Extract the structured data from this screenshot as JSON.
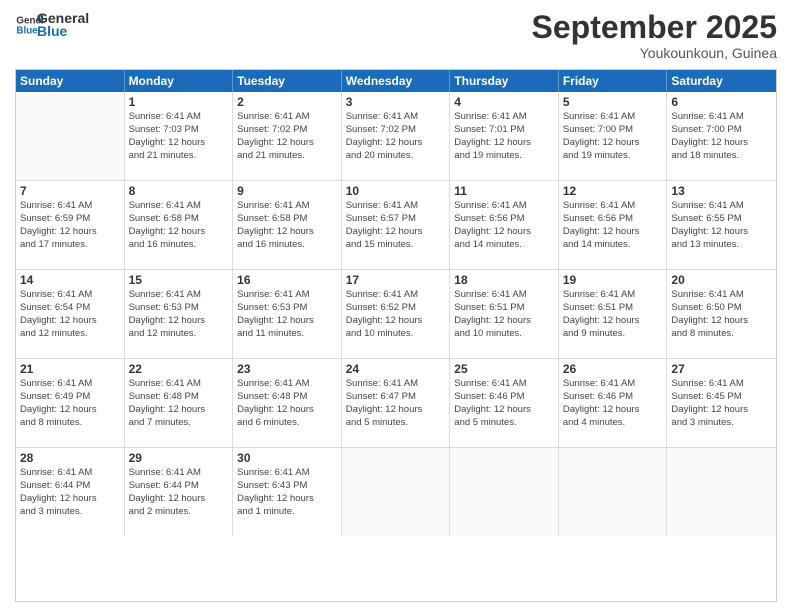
{
  "header": {
    "logo_line1": "General",
    "logo_line2": "Blue",
    "month": "September 2025",
    "location": "Youkounkoun, Guinea"
  },
  "days": [
    "Sunday",
    "Monday",
    "Tuesday",
    "Wednesday",
    "Thursday",
    "Friday",
    "Saturday"
  ],
  "weeks": [
    [
      {
        "day": "",
        "info": ""
      },
      {
        "day": "1",
        "info": "Sunrise: 6:41 AM\nSunset: 7:03 PM\nDaylight: 12 hours\nand 21 minutes."
      },
      {
        "day": "2",
        "info": "Sunrise: 6:41 AM\nSunset: 7:02 PM\nDaylight: 12 hours\nand 21 minutes."
      },
      {
        "day": "3",
        "info": "Sunrise: 6:41 AM\nSunset: 7:02 PM\nDaylight: 12 hours\nand 20 minutes."
      },
      {
        "day": "4",
        "info": "Sunrise: 6:41 AM\nSunset: 7:01 PM\nDaylight: 12 hours\nand 19 minutes."
      },
      {
        "day": "5",
        "info": "Sunrise: 6:41 AM\nSunset: 7:00 PM\nDaylight: 12 hours\nand 19 minutes."
      },
      {
        "day": "6",
        "info": "Sunrise: 6:41 AM\nSunset: 7:00 PM\nDaylight: 12 hours\nand 18 minutes."
      }
    ],
    [
      {
        "day": "7",
        "info": "Sunrise: 6:41 AM\nSunset: 6:59 PM\nDaylight: 12 hours\nand 17 minutes."
      },
      {
        "day": "8",
        "info": "Sunrise: 6:41 AM\nSunset: 6:58 PM\nDaylight: 12 hours\nand 16 minutes."
      },
      {
        "day": "9",
        "info": "Sunrise: 6:41 AM\nSunset: 6:58 PM\nDaylight: 12 hours\nand 16 minutes."
      },
      {
        "day": "10",
        "info": "Sunrise: 6:41 AM\nSunset: 6:57 PM\nDaylight: 12 hours\nand 15 minutes."
      },
      {
        "day": "11",
        "info": "Sunrise: 6:41 AM\nSunset: 6:56 PM\nDaylight: 12 hours\nand 14 minutes."
      },
      {
        "day": "12",
        "info": "Sunrise: 6:41 AM\nSunset: 6:56 PM\nDaylight: 12 hours\nand 14 minutes."
      },
      {
        "day": "13",
        "info": "Sunrise: 6:41 AM\nSunset: 6:55 PM\nDaylight: 12 hours\nand 13 minutes."
      }
    ],
    [
      {
        "day": "14",
        "info": "Sunrise: 6:41 AM\nSunset: 6:54 PM\nDaylight: 12 hours\nand 12 minutes."
      },
      {
        "day": "15",
        "info": "Sunrise: 6:41 AM\nSunset: 6:53 PM\nDaylight: 12 hours\nand 12 minutes."
      },
      {
        "day": "16",
        "info": "Sunrise: 6:41 AM\nSunset: 6:53 PM\nDaylight: 12 hours\nand 11 minutes."
      },
      {
        "day": "17",
        "info": "Sunrise: 6:41 AM\nSunset: 6:52 PM\nDaylight: 12 hours\nand 10 minutes."
      },
      {
        "day": "18",
        "info": "Sunrise: 6:41 AM\nSunset: 6:51 PM\nDaylight: 12 hours\nand 10 minutes."
      },
      {
        "day": "19",
        "info": "Sunrise: 6:41 AM\nSunset: 6:51 PM\nDaylight: 12 hours\nand 9 minutes."
      },
      {
        "day": "20",
        "info": "Sunrise: 6:41 AM\nSunset: 6:50 PM\nDaylight: 12 hours\nand 8 minutes."
      }
    ],
    [
      {
        "day": "21",
        "info": "Sunrise: 6:41 AM\nSunset: 6:49 PM\nDaylight: 12 hours\nand 8 minutes."
      },
      {
        "day": "22",
        "info": "Sunrise: 6:41 AM\nSunset: 6:48 PM\nDaylight: 12 hours\nand 7 minutes."
      },
      {
        "day": "23",
        "info": "Sunrise: 6:41 AM\nSunset: 6:48 PM\nDaylight: 12 hours\nand 6 minutes."
      },
      {
        "day": "24",
        "info": "Sunrise: 6:41 AM\nSunset: 6:47 PM\nDaylight: 12 hours\nand 5 minutes."
      },
      {
        "day": "25",
        "info": "Sunrise: 6:41 AM\nSunset: 6:46 PM\nDaylight: 12 hours\nand 5 minutes."
      },
      {
        "day": "26",
        "info": "Sunrise: 6:41 AM\nSunset: 6:46 PM\nDaylight: 12 hours\nand 4 minutes."
      },
      {
        "day": "27",
        "info": "Sunrise: 6:41 AM\nSunset: 6:45 PM\nDaylight: 12 hours\nand 3 minutes."
      }
    ],
    [
      {
        "day": "28",
        "info": "Sunrise: 6:41 AM\nSunset: 6:44 PM\nDaylight: 12 hours\nand 3 minutes."
      },
      {
        "day": "29",
        "info": "Sunrise: 6:41 AM\nSunset: 6:44 PM\nDaylight: 12 hours\nand 2 minutes."
      },
      {
        "day": "30",
        "info": "Sunrise: 6:41 AM\nSunset: 6:43 PM\nDaylight: 12 hours\nand 1 minute."
      },
      {
        "day": "",
        "info": ""
      },
      {
        "day": "",
        "info": ""
      },
      {
        "day": "",
        "info": ""
      },
      {
        "day": "",
        "info": ""
      }
    ]
  ]
}
